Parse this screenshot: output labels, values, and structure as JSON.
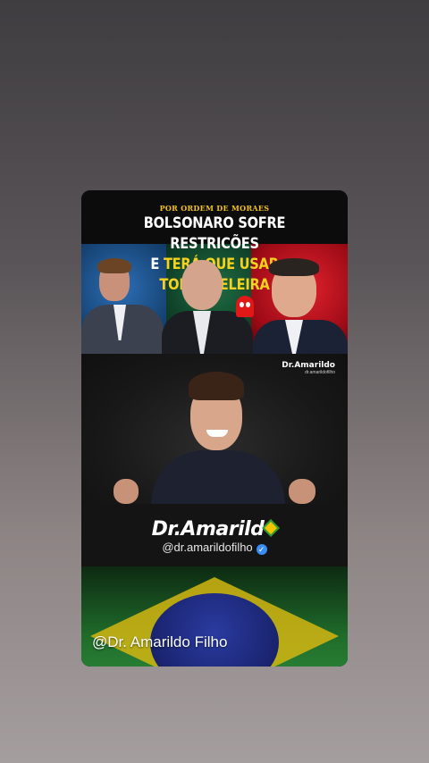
{
  "post": {
    "thumbnail": {
      "kicker": "POR ORDEM DE MORAES",
      "headline_line1": "BOLSONARO SOFRE RESTRICÕES",
      "headline_line2_prefix": "E",
      "headline_line2_highlight": "TERÁ QUE USAR TORNOZELEIRA"
    },
    "video": {
      "watermark_name": "Dr.Amarildo",
      "watermark_handle": "dr.amarildofilho"
    },
    "branding": {
      "logo_text": "Dr.Amarild",
      "handle": "@dr.amarildofilho",
      "verified_glyph": "✓"
    },
    "caption": "@Dr. Amarildo Filho"
  },
  "colors": {
    "highlight_yellow": "#f6d11e",
    "kicker_yellow": "#f3c21a",
    "verified_blue": "#3a8ef6",
    "flag_green": "#2e8b3a",
    "flag_yellow": "#d4b612",
    "flag_blue": "#1a2470"
  },
  "icons": [
    "ghost-icon",
    "verified-badge-icon",
    "flag-diamond-logo-icon"
  ]
}
